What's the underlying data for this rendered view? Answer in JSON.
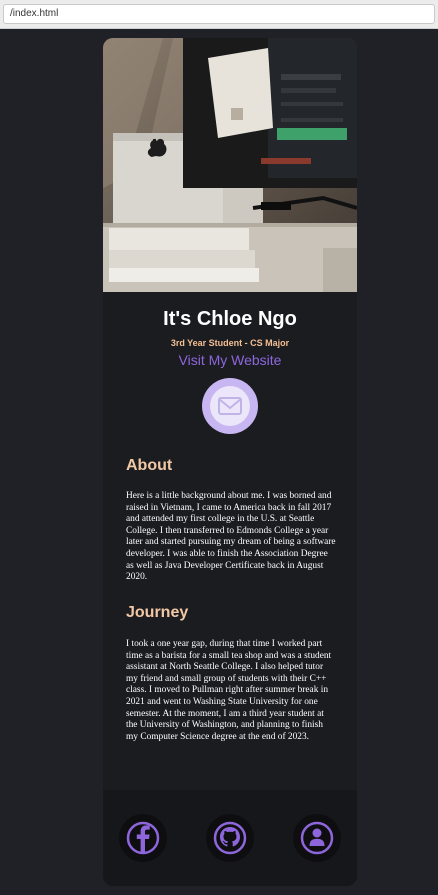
{
  "browser": {
    "url": "/index.html"
  },
  "profile": {
    "name": "It's Chloe Ngo",
    "subtitle": "3rd Year Student - CS Major",
    "website_label": "Visit My Website"
  },
  "about": {
    "heading": "About",
    "text": "Here is a little background about me. I was borned and raised in Vietnam, I came to America back in fall 2017 and attended my first college in the U.S. at Seattle College. I then transferred to Edmonds College a year later and started pursuing my dream of being a software developer. I was able to finish the Association Degree as well as Java Developer Certificate back in August 2020."
  },
  "journey": {
    "heading": "Journey",
    "text": "I took a one year gap, during that time I worked part time as a barista for a small tea shop and was a student assistant at North Seattle College. I also helped tutor my friend and small group of students with their C++ class. I moved to Pullman right after summer break in 2021 and went to Washing State University for one semester. At the moment, I am a third year student at the University of Washington, and planning to finish my Computer Science degree at the end of 2023."
  },
  "icons": {
    "email": "mail-icon",
    "facebook": "facebook-icon",
    "github": "github-icon",
    "profile": "person-icon"
  },
  "colors": {
    "page_background": "#202126",
    "card_background": "#1b1c20",
    "accent_purple": "#8d66dc",
    "heading_peach": "#f3c8a5",
    "subtitle_orange": "#f3bf93"
  }
}
